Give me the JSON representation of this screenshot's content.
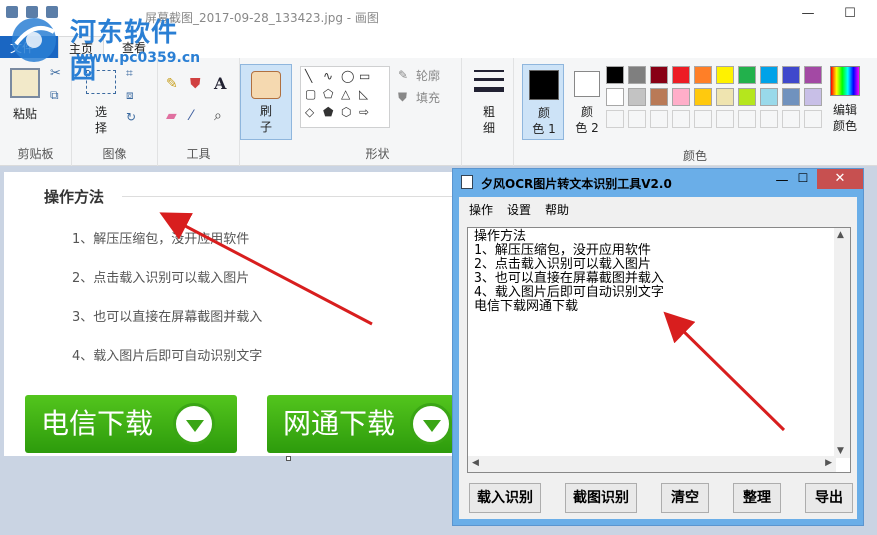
{
  "app": {
    "window_title": "屏幕截图_2017-09-28_133423.jpg - 画图",
    "minimize_glyph": "—",
    "maximize_glyph": "☐"
  },
  "watermark": {
    "title": "河东软件园",
    "url": "www.pc0359.cn"
  },
  "tabs": {
    "file": "文件",
    "home": "主页",
    "view": "查看"
  },
  "ribbon": {
    "clipboard": {
      "paste": "粘贴",
      "label": "剪贴板"
    },
    "image": {
      "select_line1": "选",
      "select_line2": "择",
      "label": "图像"
    },
    "tools": {
      "label": "工具",
      "text_glyph": "A"
    },
    "brush": {
      "line1": "刷",
      "line2": "子"
    },
    "shapes": {
      "outline": "轮廓",
      "fill": "填充",
      "label": "形状"
    },
    "size": {
      "line1": "粗",
      "line2": "细"
    },
    "color1": {
      "line1": "颜",
      "line2": "色 1"
    },
    "color2": {
      "line1": "颜",
      "line2": "色 2"
    },
    "colors": {
      "label": "颜色",
      "edit_line1": "编辑",
      "edit_line2": "颜色",
      "palette_row1": [
        "#000000",
        "#7f7f7f",
        "#880015",
        "#ed1c24",
        "#ff7f27",
        "#fff200",
        "#22b14c",
        "#00a2e8",
        "#3f48cc",
        "#a349a4"
      ],
      "palette_row2": [
        "#ffffff",
        "#c3c3c3",
        "#b97a57",
        "#ffaec9",
        "#ffc90e",
        "#efe4b0",
        "#b5e61d",
        "#99d9ea",
        "#7092be",
        "#c8bfe7"
      ]
    }
  },
  "canvas": {
    "heading": "操作方法",
    "steps": [
      "1、解压压缩包，没开应用软件",
      "2、点击载入识别可以载入图片",
      "3、也可以直接在屏幕截图并载入",
      "4、载入图片后即可自动识别文字"
    ],
    "btn_telecom": "电信下载",
    "btn_netcom": "网通下载"
  },
  "ocr": {
    "title": "夕风OCR图片转文本识别工具V2.0",
    "close_glyph": "✕",
    "menu": [
      "操作",
      "设置",
      "帮助"
    ],
    "text_lines": [
      "操作方法",
      "1、解压压缩包，没开应用软件",
      "2、点击载入识别可以载入图片",
      "3、也可以直接在屏幕截图并载入",
      "4、载入图片后即可自动识别文字",
      "电信下载网通下载"
    ],
    "buttons": [
      "载入识别",
      "截图识别",
      "清空",
      "整理",
      "导出"
    ]
  }
}
